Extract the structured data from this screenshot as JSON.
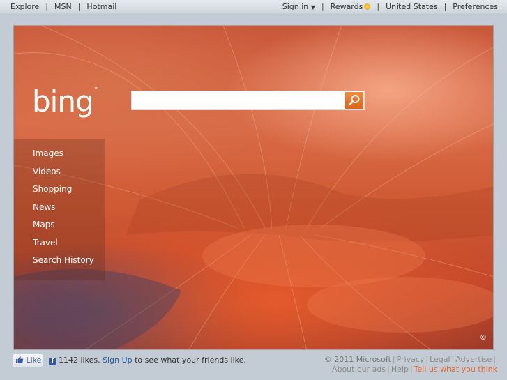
{
  "top_nav": {
    "left": [
      "Explore",
      "MSN",
      "Hotmail"
    ],
    "sign_in": "Sign in",
    "rewards": "Rewards",
    "country": "United States",
    "preferences": "Preferences"
  },
  "logo": {
    "text": "bing",
    "mark": "™"
  },
  "search": {
    "value": "",
    "placeholder": ""
  },
  "side_nav": [
    "Images",
    "Videos",
    "Shopping",
    "News",
    "Maps",
    "Travel",
    "Search History"
  ],
  "image_copyright_symbol": "©",
  "social": {
    "like_label": "Like",
    "likes_text": "1142 likes.",
    "signup_link": "Sign Up",
    "signup_suffix": "to see what your friends like."
  },
  "footer": {
    "copyright": "© 2011 Microsoft",
    "links": [
      "Privacy",
      "Legal",
      "Advertise",
      "About our ads",
      "Help"
    ],
    "feedback": "Tell us what you think"
  },
  "colors": {
    "accent_orange": "#e8672b",
    "link_blue": "#1f5ca8",
    "facebook_blue": "#3b5998"
  }
}
